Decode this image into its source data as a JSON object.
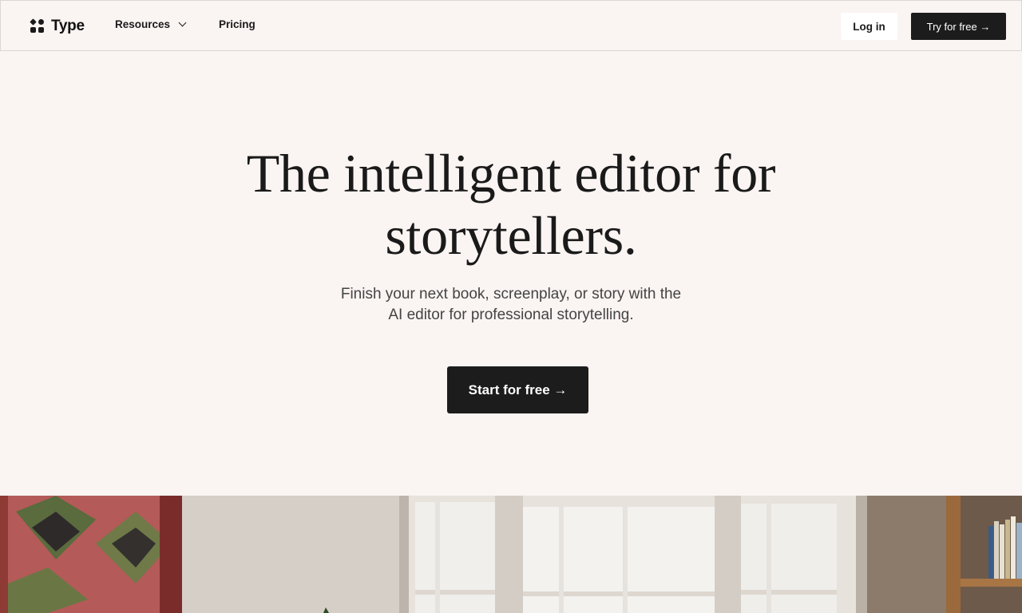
{
  "nav": {
    "brand": "Type",
    "resources": "Resources",
    "pricing": "Pricing",
    "login": "Log in",
    "try": "Try for free →"
  },
  "hero": {
    "title_line1": "The intelligent editor for",
    "title_line2": "storytellers.",
    "subtitle_line1": "Finish your next book, screenplay, or story with the",
    "subtitle_line2": "AI editor for professional storytelling.",
    "cta": "Start for free →"
  },
  "colors": {
    "background": "#faf4f2",
    "button_dark": "#1c1c1c",
    "text": "#1a1a1a"
  },
  "icons": [
    "type-logo-icon",
    "chevron-down-icon"
  ]
}
